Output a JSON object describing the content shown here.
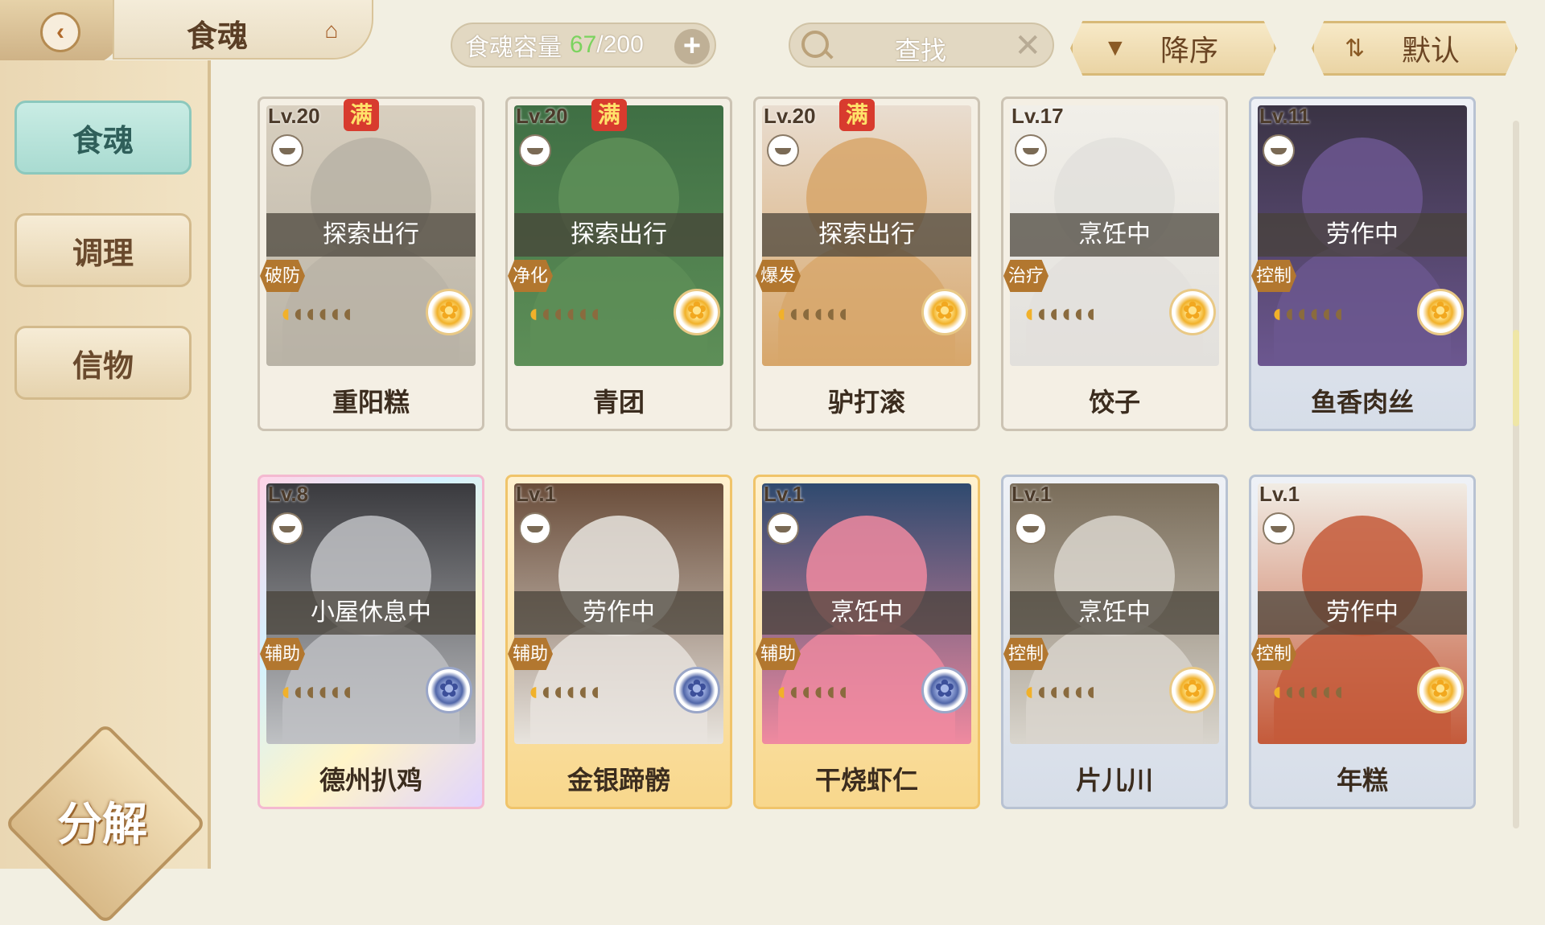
{
  "header": {
    "title": "食魂",
    "capacity_label": "食魂容量",
    "capacity_current": "67",
    "capacity_sep": "/",
    "capacity_max": "200",
    "plus": "+",
    "search_placeholder": "查找",
    "sort_order": "降序",
    "sort_mode": "默认"
  },
  "sidebar": {
    "tabs": [
      "食魂",
      "调理",
      "信物"
    ],
    "decompose": "分解"
  },
  "cards": [
    {
      "lv": "Lv.20",
      "full": "满",
      "status": "探索出行",
      "role": "破防",
      "name": "重阳糕",
      "stars_lit": 1,
      "stars_total": 6,
      "frame": "white",
      "flower": "gold",
      "colors": [
        "#b9b3a6",
        "#d8cfbf"
      ]
    },
    {
      "lv": "Lv.20",
      "full": "满",
      "status": "探索出行",
      "role": "净化",
      "name": "青团",
      "stars_lit": 1,
      "stars_total": 6,
      "frame": "white",
      "flower": "gold",
      "colors": [
        "#5e8f58",
        "#3f6f44"
      ]
    },
    {
      "lv": "Lv.20",
      "full": "满",
      "status": "探索出行",
      "role": "爆发",
      "name": "驴打滚",
      "stars_lit": 1,
      "stars_total": 6,
      "frame": "white",
      "flower": "gold",
      "colors": [
        "#d7a66a",
        "#e9ddd0"
      ]
    },
    {
      "lv": "Lv.17",
      "full": "",
      "status": "烹饪中",
      "role": "治疗",
      "name": "饺子",
      "stars_lit": 1,
      "stars_total": 6,
      "frame": "white",
      "flower": "gold",
      "colors": [
        "#e2e0dc",
        "#f1efe9"
      ]
    },
    {
      "lv": "Lv.11",
      "full": "",
      "status": "劳作中",
      "role": "控制",
      "name": "鱼香肉丝",
      "stars_lit": 1,
      "stars_total": 6,
      "frame": "silver",
      "flower": "gold",
      "colors": [
        "#6c5790",
        "#3a3344"
      ]
    },
    {
      "lv": "Lv.8",
      "full": "",
      "status": "小屋休息中",
      "role": "辅助",
      "name": "德州扒鸡",
      "stars_lit": 1,
      "stars_total": 6,
      "frame": "rainbow",
      "flower": "blue",
      "colors": [
        "#bfc1c4",
        "#3a3a3e"
      ]
    },
    {
      "lv": "Lv.1",
      "full": "",
      "status": "劳作中",
      "role": "辅助",
      "name": "金银蹄髈",
      "stars_lit": 1,
      "stars_total": 6,
      "frame": "gold",
      "flower": "blue",
      "colors": [
        "#e8e4de",
        "#6a4d3a"
      ]
    },
    {
      "lv": "Lv.1",
      "full": "",
      "status": "烹饪中",
      "role": "辅助",
      "name": "干烧虾仁",
      "stars_lit": 1,
      "stars_total": 6,
      "frame": "gold",
      "flower": "blue",
      "colors": [
        "#f08aa0",
        "#2f4a6f"
      ]
    },
    {
      "lv": "Lv.1",
      "full": "",
      "status": "烹饪中",
      "role": "控制",
      "name": "片儿川",
      "stars_lit": 1,
      "stars_total": 6,
      "frame": "silver",
      "flower": "gold",
      "colors": [
        "#d9d5cd",
        "#7a6d5a"
      ]
    },
    {
      "lv": "Lv.1",
      "full": "",
      "status": "劳作中",
      "role": "控制",
      "name": "年糕",
      "stars_lit": 1,
      "stars_total": 6,
      "frame": "silver",
      "flower": "gold",
      "colors": [
        "#c45a3a",
        "#f1ece4"
      ]
    }
  ]
}
